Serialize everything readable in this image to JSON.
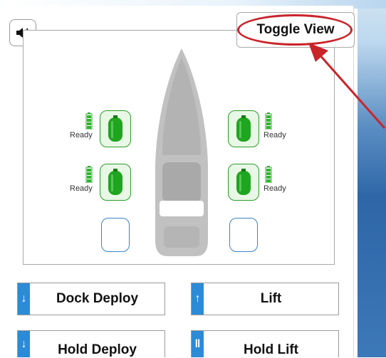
{
  "toolbar": {
    "sound_icon": "speaker-icon",
    "toggle_label": "Toggle View"
  },
  "fenders": {
    "front_left": {
      "status": "Ready",
      "battery_level": 1.0
    },
    "rear_left": {
      "status": "Ready",
      "battery_level": 1.0
    },
    "front_right": {
      "status": "Ready",
      "battery_level": 1.0
    },
    "rear_right": {
      "status": "Ready",
      "battery_level": 1.0
    }
  },
  "controls": {
    "dock_deploy": {
      "label": "Dock Deploy",
      "glyph": "↓"
    },
    "lift": {
      "label": "Lift",
      "glyph": "↑"
    },
    "hold_deploy": {
      "label": "Hold Deploy",
      "glyph": "↓"
    },
    "hold_lift": {
      "label": "Hold Lift",
      "glyph": "‖"
    }
  },
  "colors": {
    "accent_blue": "#2c8bd6",
    "fender_green": "#1fa51f",
    "annotation_red": "#c9242a",
    "boat_gray": "#bdbdbd"
  }
}
